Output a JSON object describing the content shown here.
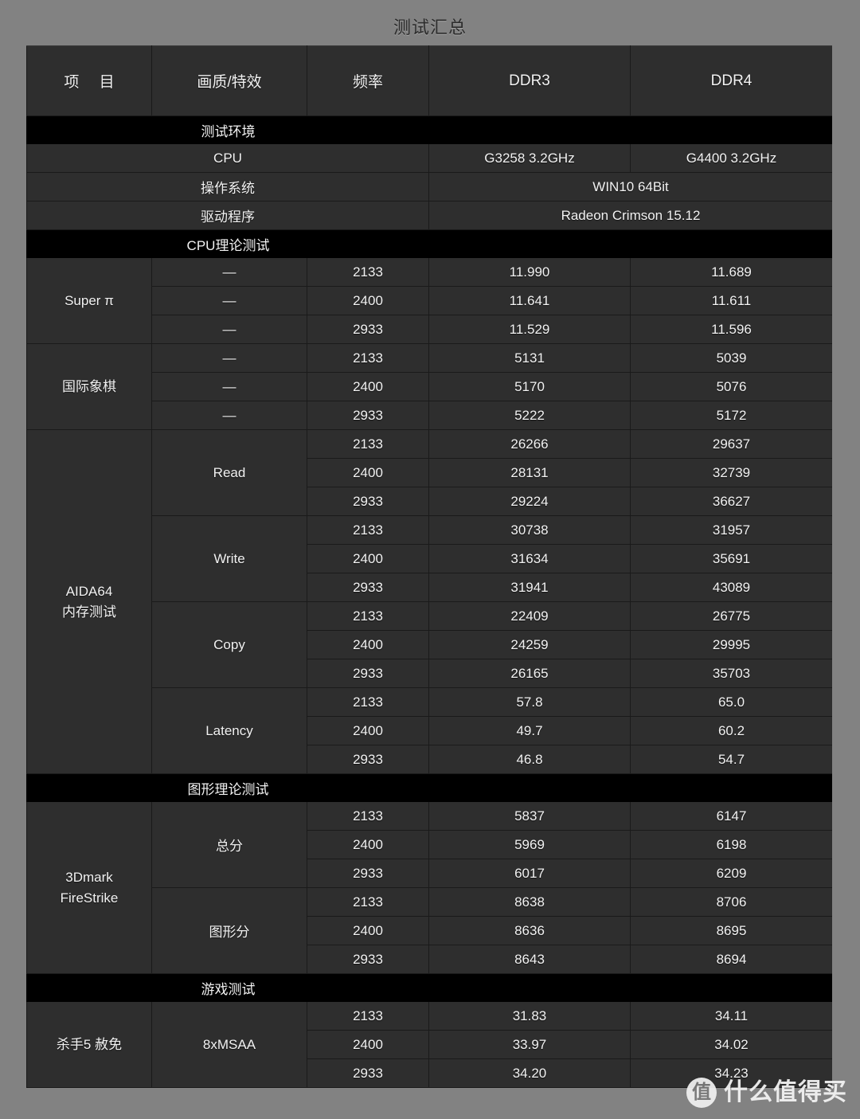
{
  "title": "测试汇总",
  "columns": {
    "item": "项 目",
    "quality": "画质/特效",
    "frequency": "频率",
    "ddr3": "DDR3",
    "ddr4": "DDR4"
  },
  "sections": {
    "environment": "测试环境",
    "cpu_theory": "CPU理论测试",
    "graphics_theory": "图形理论测试",
    "game": "游戏测试"
  },
  "environment_rows": [
    {
      "label": "CPU",
      "ddr3": "G3258 3.2GHz",
      "ddr4": "G4400 3.2GHz",
      "merged": false
    },
    {
      "label": "操作系统",
      "value": "WIN10 64Bit",
      "merged": true
    },
    {
      "label": "驱动程序",
      "value": "Radeon Crimson 15.12",
      "merged": true
    }
  ],
  "benchmarks": [
    {
      "name": "Super π",
      "groups": [
        {
          "quality": "—",
          "per_row_quality": true,
          "rows": [
            {
              "freq": "2133",
              "ddr3": "11.990",
              "ddr4": "11.689"
            },
            {
              "freq": "2400",
              "ddr3": "11.641",
              "ddr4": "11.611"
            },
            {
              "freq": "2933",
              "ddr3": "11.529",
              "ddr4": "11.596"
            }
          ]
        }
      ]
    },
    {
      "name": "国际象棋",
      "groups": [
        {
          "quality": "—",
          "per_row_quality": true,
          "rows": [
            {
              "freq": "2133",
              "ddr3": "5131",
              "ddr4": "5039"
            },
            {
              "freq": "2400",
              "ddr3": "5170",
              "ddr4": "5076"
            },
            {
              "freq": "2933",
              "ddr3": "5222",
              "ddr4": "5172"
            }
          ]
        }
      ]
    },
    {
      "name": "AIDA64\n内存测试",
      "name_line1": "AIDA64",
      "name_line2": "内存测试",
      "groups": [
        {
          "quality": "Read",
          "per_row_quality": false,
          "rows": [
            {
              "freq": "2133",
              "ddr3": "26266",
              "ddr4": "29637"
            },
            {
              "freq": "2400",
              "ddr3": "28131",
              "ddr4": "32739"
            },
            {
              "freq": "2933",
              "ddr3": "29224",
              "ddr4": "36627"
            }
          ]
        },
        {
          "quality": "Write",
          "per_row_quality": false,
          "rows": [
            {
              "freq": "2133",
              "ddr3": "30738",
              "ddr4": "31957"
            },
            {
              "freq": "2400",
              "ddr3": "31634",
              "ddr4": "35691"
            },
            {
              "freq": "2933",
              "ddr3": "31941",
              "ddr4": "43089"
            }
          ]
        },
        {
          "quality": "Copy",
          "per_row_quality": false,
          "rows": [
            {
              "freq": "2133",
              "ddr3": "22409",
              "ddr4": "26775"
            },
            {
              "freq": "2400",
              "ddr3": "24259",
              "ddr4": "29995"
            },
            {
              "freq": "2933",
              "ddr3": "26165",
              "ddr4": "35703"
            }
          ]
        },
        {
          "quality": "Latency",
          "per_row_quality": false,
          "rows": [
            {
              "freq": "2133",
              "ddr3": "57.8",
              "ddr4": "65.0"
            },
            {
              "freq": "2400",
              "ddr3": "49.7",
              "ddr4": "60.2"
            },
            {
              "freq": "2933",
              "ddr3": "46.8",
              "ddr4": "54.7"
            }
          ]
        }
      ]
    },
    {
      "name_line1": "3Dmark",
      "name_line2": "FireStrike",
      "groups": [
        {
          "quality": "总分",
          "per_row_quality": false,
          "rows": [
            {
              "freq": "2133",
              "ddr3": "5837",
              "ddr4": "6147"
            },
            {
              "freq": "2400",
              "ddr3": "5969",
              "ddr4": "6198"
            },
            {
              "freq": "2933",
              "ddr3": "6017",
              "ddr4": "6209"
            }
          ]
        },
        {
          "quality": "图形分",
          "per_row_quality": false,
          "rows": [
            {
              "freq": "2133",
              "ddr3": "8638",
              "ddr4": "8706"
            },
            {
              "freq": "2400",
              "ddr3": "8636",
              "ddr4": "8695"
            },
            {
              "freq": "2933",
              "ddr3": "8643",
              "ddr4": "8694"
            }
          ]
        }
      ]
    },
    {
      "name_line1": "杀手5 赦免",
      "name_line2": "",
      "groups": [
        {
          "quality": "8xMSAA",
          "per_row_quality": false,
          "rows": [
            {
              "freq": "2133",
              "ddr3": "31.83",
              "ddr4": "34.11"
            },
            {
              "freq": "2400",
              "ddr3": "33.97",
              "ddr4": "34.02"
            },
            {
              "freq": "2933",
              "ddr3": "34.20",
              "ddr4": "34.23"
            }
          ]
        }
      ]
    }
  ],
  "watermark": {
    "badge": "值",
    "text": "什么值得买"
  },
  "colors": {
    "page_background": "#828282",
    "cell_background": "#2e2e2e",
    "section_background": "#000000",
    "text": "#f2f2f2",
    "title_text": "#2c2c2c"
  }
}
